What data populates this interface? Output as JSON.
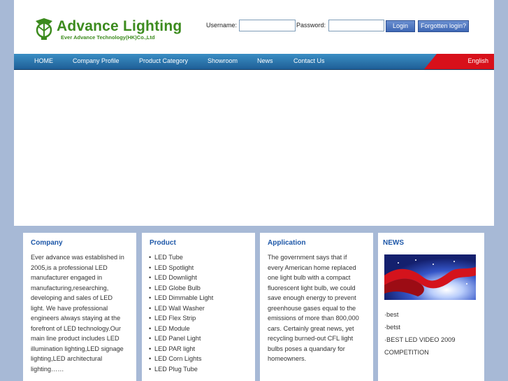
{
  "header": {
    "logo_title": "Advance Lighting",
    "logo_subtitle": "Ever Advance Technology(HK)Co.,Ltd",
    "username_label": "Username:",
    "password_label": "Password:",
    "login_button": "Login",
    "forgot_button": "Forgotten login?"
  },
  "nav": {
    "items": [
      "HOME",
      "Company Profile",
      "Product Category",
      "Showroom",
      "News",
      "Contact Us"
    ],
    "language": "English"
  },
  "company": {
    "title": "Company",
    "lines": [
      "Ever advance was established in",
      "2005,is a professional LED",
      "manufacturer engaged in",
      "manufacturing,researching,",
      "developing and sales of LED",
      "light. We have professional",
      "engineers always staying at the",
      "forefront of LED technology.Our",
      "main line product includes LED",
      "illumination lighting,LED signage",
      "lighting,LED architectural",
      "lighting……"
    ]
  },
  "product": {
    "title": "Product",
    "items": [
      "LED Tube",
      "LED Spotlight",
      "LED Downlight",
      "LED Globe Bulb",
      "LED Dimmable Light",
      "LED Wall Washer",
      "LED Flex Strip",
      "LED Module",
      "LED Panel Light",
      "LED PAR light",
      "LED Corn Lights",
      "LED Plug Tube"
    ]
  },
  "application": {
    "title": "Application",
    "lines": [
      "The government says that if",
      "every American home replaced",
      "one light bulb with a compact",
      "fluorescent light bulb, we could",
      "save enough energy to prevent",
      "greenhouse gases equal to the",
      "emissions of more than 800,000",
      "cars. Certainly great news, yet",
      "recycling burned-out CFL light",
      "bulbs poses a quandary for",
      "homeowners."
    ]
  },
  "news": {
    "title": "NEWS",
    "items": [
      "·best",
      "·betst",
      "·BEST LED VIDEO 2009",
      "COMPETITION"
    ]
  },
  "colors": {
    "background": "#a7b9d6",
    "nav_blue": "#2a77b3",
    "nav_red": "#d8101a",
    "logo_green": "#3c8b1e",
    "panel_title_blue": "#1d57a8"
  }
}
